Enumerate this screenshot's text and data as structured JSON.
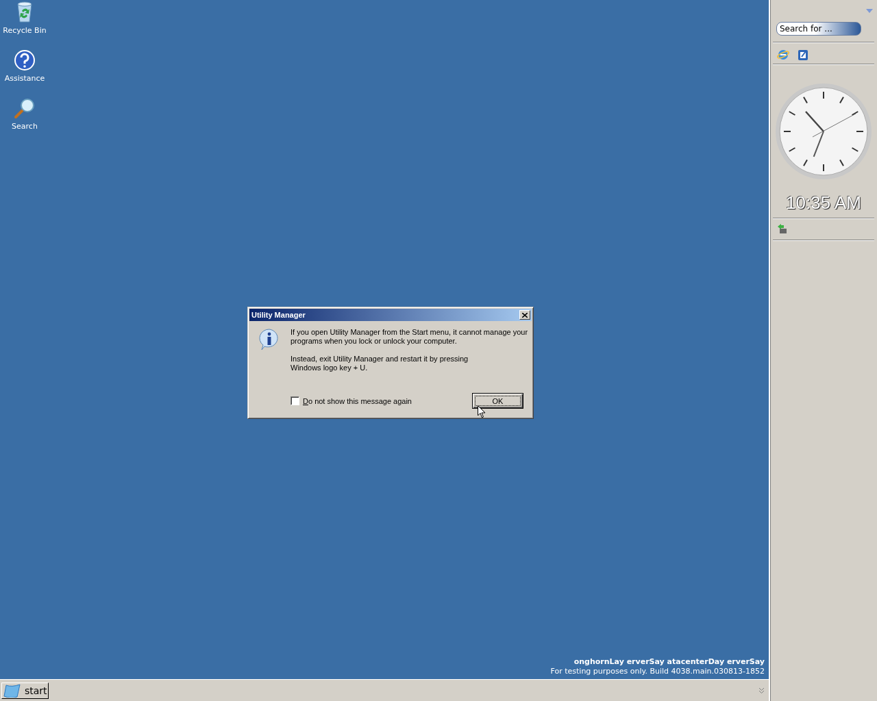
{
  "desktop_icons": [
    {
      "label": "Recycle Bin",
      "kind": "recycle"
    },
    {
      "label": "Assistance",
      "kind": "help"
    },
    {
      "label": "Search",
      "kind": "search"
    }
  ],
  "dialog": {
    "title": "Utility Manager",
    "paragraphs": [
      "If you open Utility Manager from the Start menu, it cannot manage your\nprograms when you lock or unlock your computer.",
      "Instead, exit Utility Manager and restart it by pressing\nWindows logo key + U."
    ],
    "checkbox": {
      "label": "Do not show this message again",
      "checked": false,
      "underline_first_letter": true
    },
    "buttons": [
      {
        "label": "OK",
        "default": true
      }
    ]
  },
  "build_info": [
    "onghornLay erverSay atacenterDay erverSay",
    "For testing purposes only. Build 4038.main.030813-1852"
  ],
  "taskbar": {
    "start_label": "start"
  },
  "sidebar": {
    "search": {
      "placeholder": "Search for ..."
    },
    "clock_time": "10:35 AM"
  }
}
